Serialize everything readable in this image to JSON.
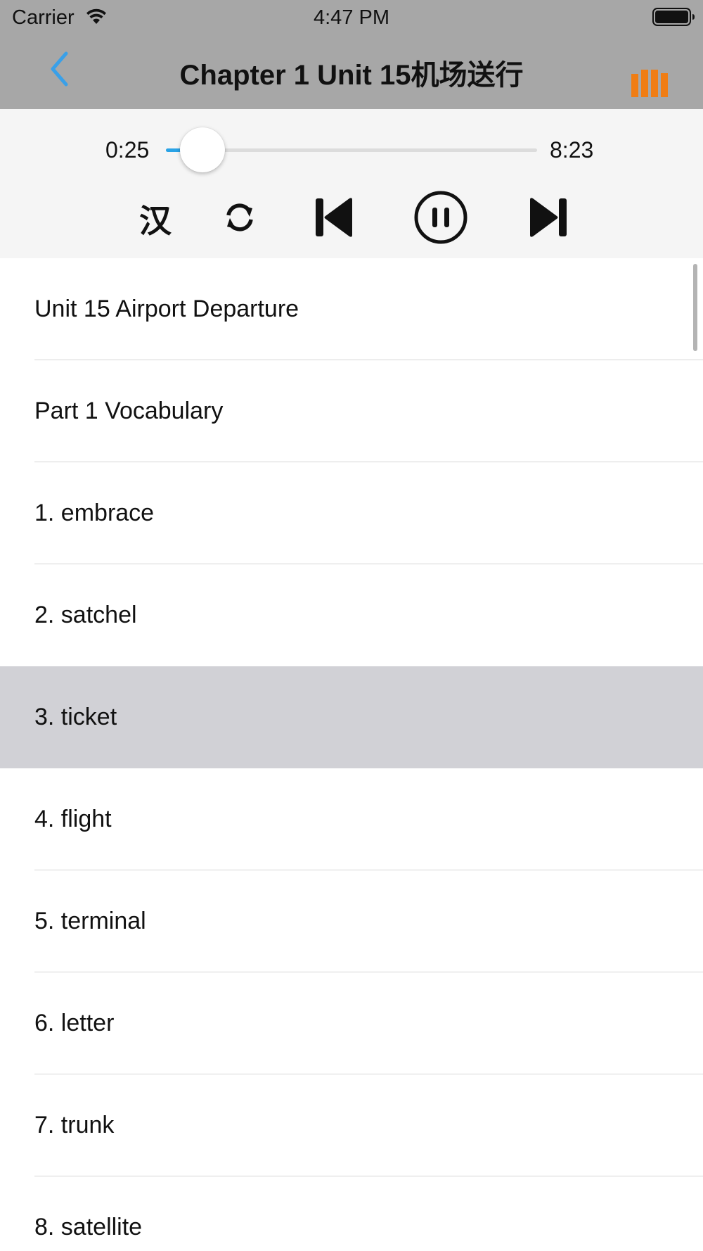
{
  "status_bar": {
    "carrier": "Carrier",
    "time": "4:47 PM",
    "wifi_icon": "wifi-icon",
    "battery_icon": "battery-icon"
  },
  "nav": {
    "title": "Chapter 1 Unit 15机场送行",
    "back_icon": "chevron-left-icon",
    "playlist_icon": "bars-icon",
    "accent_color": "#f07d14",
    "back_color": "#3aa0e8"
  },
  "player": {
    "current_time": "0:25",
    "total_time": "8:23",
    "progress_fraction": 0.05,
    "translate_label": "汉",
    "controls": [
      "translate-button",
      "repeat-icon",
      "previous-icon",
      "pause-icon",
      "next-icon"
    ],
    "progress_color": "#2aa3e6"
  },
  "list": {
    "selected_index": 4,
    "items": [
      "Unit 15 Airport Departure",
      "Part 1 Vocabulary",
      "1. embrace",
      "2. satchel",
      "3. ticket",
      "4. flight",
      "5. terminal",
      "6. letter",
      "7. trunk",
      "8. satellite"
    ]
  }
}
